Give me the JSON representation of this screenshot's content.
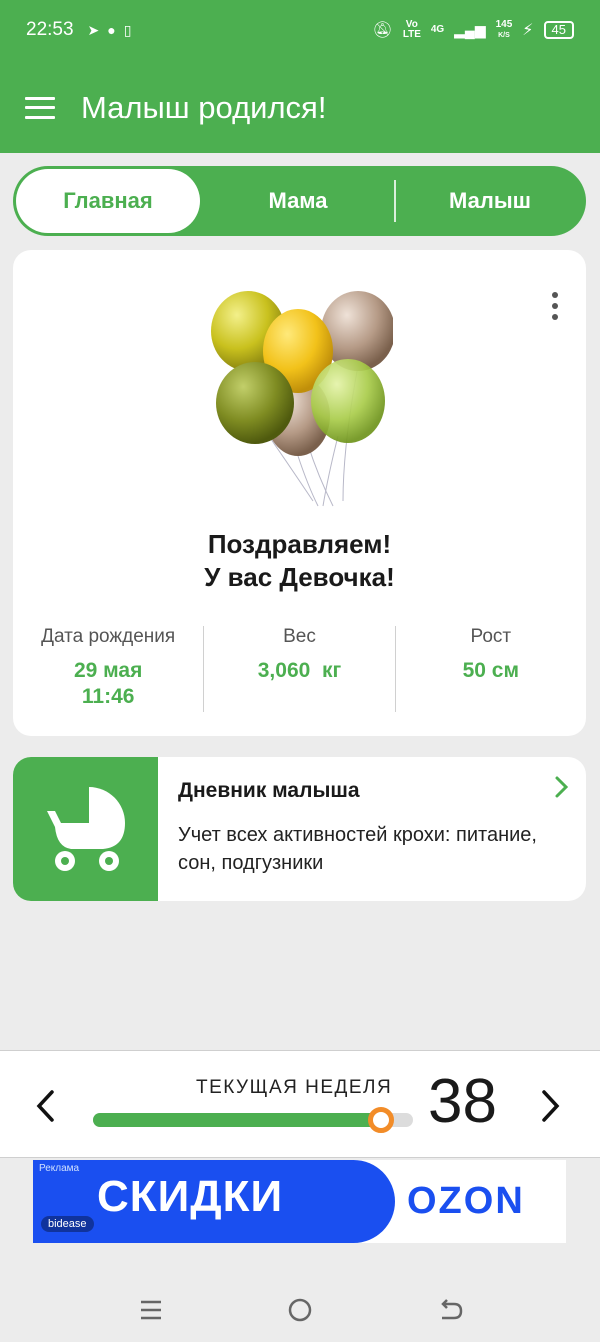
{
  "status_bar": {
    "time": "22:53",
    "network": "4G",
    "speed": "145",
    "speed_unit": "K/S",
    "volte": "Vo LTE",
    "battery": "45"
  },
  "app_bar": {
    "title": "Малыш родился!"
  },
  "tabs": [
    {
      "label": "Главная",
      "active": true
    },
    {
      "label": "Мама",
      "active": false
    },
    {
      "label": "Малыш",
      "active": false
    }
  ],
  "birth_card": {
    "congrats_line1": "Поздравляем!",
    "congrats_line2": "У вас Девочка!",
    "stats": [
      {
        "label": "Дата рождения",
        "value_line1": "29 мая",
        "value_line2": "11:46"
      },
      {
        "label": "Вес",
        "value_line1": "3,060  кг",
        "value_line2": ""
      },
      {
        "label": "Рост",
        "value_line1": "50 см",
        "value_line2": ""
      }
    ]
  },
  "diary_card": {
    "title": "Дневник малыша",
    "description": "Учет всех активностей крохи: питание, сон, подгузники"
  },
  "week": {
    "label": "ТЕКУЩАЯ НЕДЕЛЯ",
    "number": "38",
    "progress": 0.9
  },
  "ad": {
    "tag": "Реклама",
    "headline": "СКИДКИ",
    "sponsor": "bidease",
    "brand": "OZON"
  },
  "colors": {
    "primary": "#4caf50",
    "accent": "#f28c28",
    "ad_blue": "#1a4ff0"
  }
}
